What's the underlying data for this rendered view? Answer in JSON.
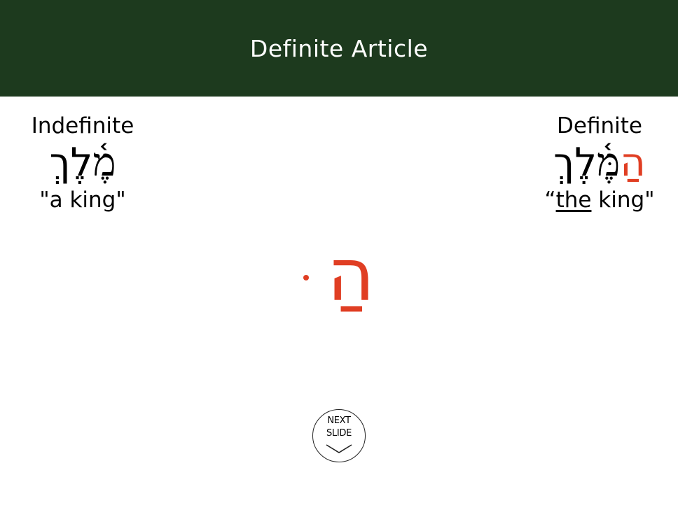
{
  "header": {
    "title": "Definite Article",
    "background": "#1d3a1e"
  },
  "accent": "#e03e23",
  "left": {
    "heading": "Indefinite",
    "hebrew": "מֶ֫לֶךְ",
    "gloss": "\"a king\""
  },
  "right": {
    "heading": "Definite",
    "hebrew_prefix": "הַ",
    "hebrew_rest": "מֶּ֫לֶךְ",
    "gloss_open": "“",
    "gloss_underlined": "the",
    "gloss_rest": " king\""
  },
  "center": {
    "glyph": "הַ"
  },
  "next_button": {
    "line1": "NEXT",
    "line2": "SLIDE",
    "icon": "chevron-down-icon"
  }
}
